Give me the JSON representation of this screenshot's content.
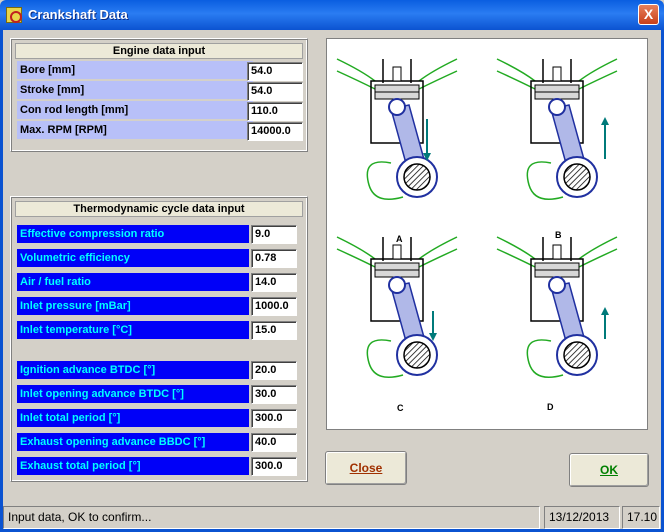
{
  "window": {
    "title": "Crankshaft Data",
    "close_label": "X"
  },
  "engine": {
    "title": "Engine data input",
    "rows": [
      {
        "label": "Bore [mm]",
        "value": "54.0"
      },
      {
        "label": "Stroke [mm]",
        "value": "54.0"
      },
      {
        "label": "Con rod length [mm]",
        "value": "110.0"
      },
      {
        "label": "Max. RPM [RPM]",
        "value": "14000.0"
      }
    ]
  },
  "thermo": {
    "title": "Thermodynamic cycle data input",
    "rows": [
      {
        "label": "Effective compression ratio",
        "value": "9.0"
      },
      {
        "label": "Volumetric efficiency",
        "value": "0.78"
      },
      {
        "label": "Air / fuel ratio",
        "value": "14.0"
      },
      {
        "label": "Inlet pressure [mBar]",
        "value": "1000.0"
      },
      {
        "label": "Inlet temperature [°C]",
        "value": "15.0"
      },
      {
        "label": "Ignition advance BTDC [°]",
        "value": "20.0"
      },
      {
        "label": "Inlet opening advance BTDC [°]",
        "value": "30.0"
      },
      {
        "label": "Inlet total period [°]",
        "value": "300.0"
      },
      {
        "label": "Exhaust opening advance BBDC [°]",
        "value": "40.0"
      },
      {
        "label": "Exhaust total period [°]",
        "value": "300.0"
      }
    ]
  },
  "diagram": {
    "labels": [
      "A",
      "B",
      "C",
      "D"
    ]
  },
  "buttons": {
    "close": "Close",
    "ok": "OK"
  },
  "status": {
    "message": "Input data, OK to confirm...",
    "date": "13/12/2013",
    "time": "17.10"
  }
}
